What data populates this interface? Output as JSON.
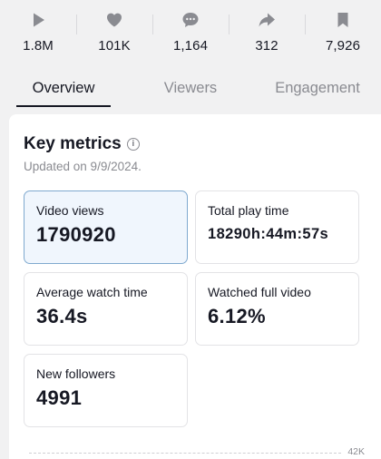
{
  "stats": [
    {
      "icon": "play-icon",
      "value": "1.8M"
    },
    {
      "icon": "heart-icon",
      "value": "101K"
    },
    {
      "icon": "comment-icon",
      "value": "1,164"
    },
    {
      "icon": "share-icon",
      "value": "312"
    },
    {
      "icon": "bookmark-icon",
      "value": "7,926"
    }
  ],
  "tabs": [
    {
      "label": "Overview",
      "active": true
    },
    {
      "label": "Viewers",
      "active": false
    },
    {
      "label": "Engagement",
      "active": false
    }
  ],
  "metrics": {
    "title": "Key metrics",
    "info_glyph": "i",
    "updated": "Updated on 9/9/2024.",
    "cards": [
      {
        "label": "Video views",
        "value": "1790920",
        "selected": true
      },
      {
        "label": "Total play time",
        "value": "18290h:44m:57s",
        "selected": false
      },
      {
        "label": "Average watch time",
        "value": "36.4s",
        "selected": false
      },
      {
        "label": "Watched full video",
        "value": "6.12%",
        "selected": false
      },
      {
        "label": "New followers",
        "value": "4991",
        "selected": false
      }
    ]
  },
  "chart": {
    "top_tick": "42K"
  },
  "colors": {
    "background": "#f1f1f2",
    "text": "#161823",
    "muted": "#8a8b91",
    "selected_card_bg": "#f0f6fd",
    "selected_card_border": "#7fa9cf"
  }
}
